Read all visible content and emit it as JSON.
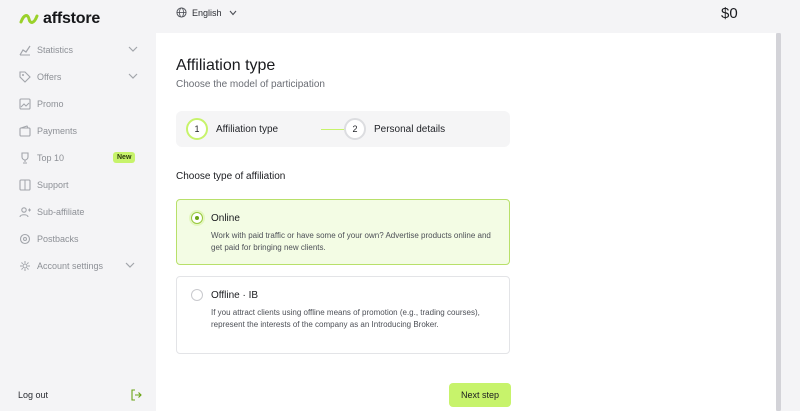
{
  "brand": {
    "name": "affstore",
    "accent": "#c7f36b"
  },
  "sidebar": {
    "items": [
      {
        "label": "Statistics",
        "icon": "bar-chart-icon",
        "has_chevron": true
      },
      {
        "label": "Offers",
        "icon": "tag-icon",
        "has_chevron": true
      },
      {
        "label": "Promo",
        "icon": "image-icon",
        "has_chevron": false
      },
      {
        "label": "Payments",
        "icon": "wallet-icon",
        "has_chevron": false
      },
      {
        "label": "Top 10",
        "icon": "trophy-icon",
        "has_chevron": false,
        "badge": "New"
      },
      {
        "label": "Support",
        "icon": "book-icon",
        "has_chevron": false
      },
      {
        "label": "Sub-affiliate",
        "icon": "users-icon",
        "has_chevron": false
      },
      {
        "label": "Postbacks",
        "icon": "settings-icon",
        "has_chevron": false
      },
      {
        "label": "Account settings",
        "icon": "gear-icon",
        "has_chevron": true
      }
    ],
    "logout_label": "Log out"
  },
  "topbar": {
    "language": "English",
    "balance": "$0"
  },
  "main": {
    "title": "Affiliation type",
    "subtitle": "Choose the model of participation",
    "steps": [
      {
        "number": "1",
        "label": "Affiliation type",
        "active": true
      },
      {
        "number": "2",
        "label": "Personal details",
        "active": false
      }
    ],
    "section_label": "Choose type of affiliation",
    "options": [
      {
        "title": "Online",
        "description": "Work with paid traffic or have some of your own? Advertise products online and get paid for bringing new clients.",
        "selected": true
      },
      {
        "title": "Offline · IB",
        "description": "If you attract clients using offline means of promotion (e.g., trading courses), represent the interests of the company as an Introducing Broker.",
        "selected": false
      }
    ],
    "next_label": "Next step"
  }
}
